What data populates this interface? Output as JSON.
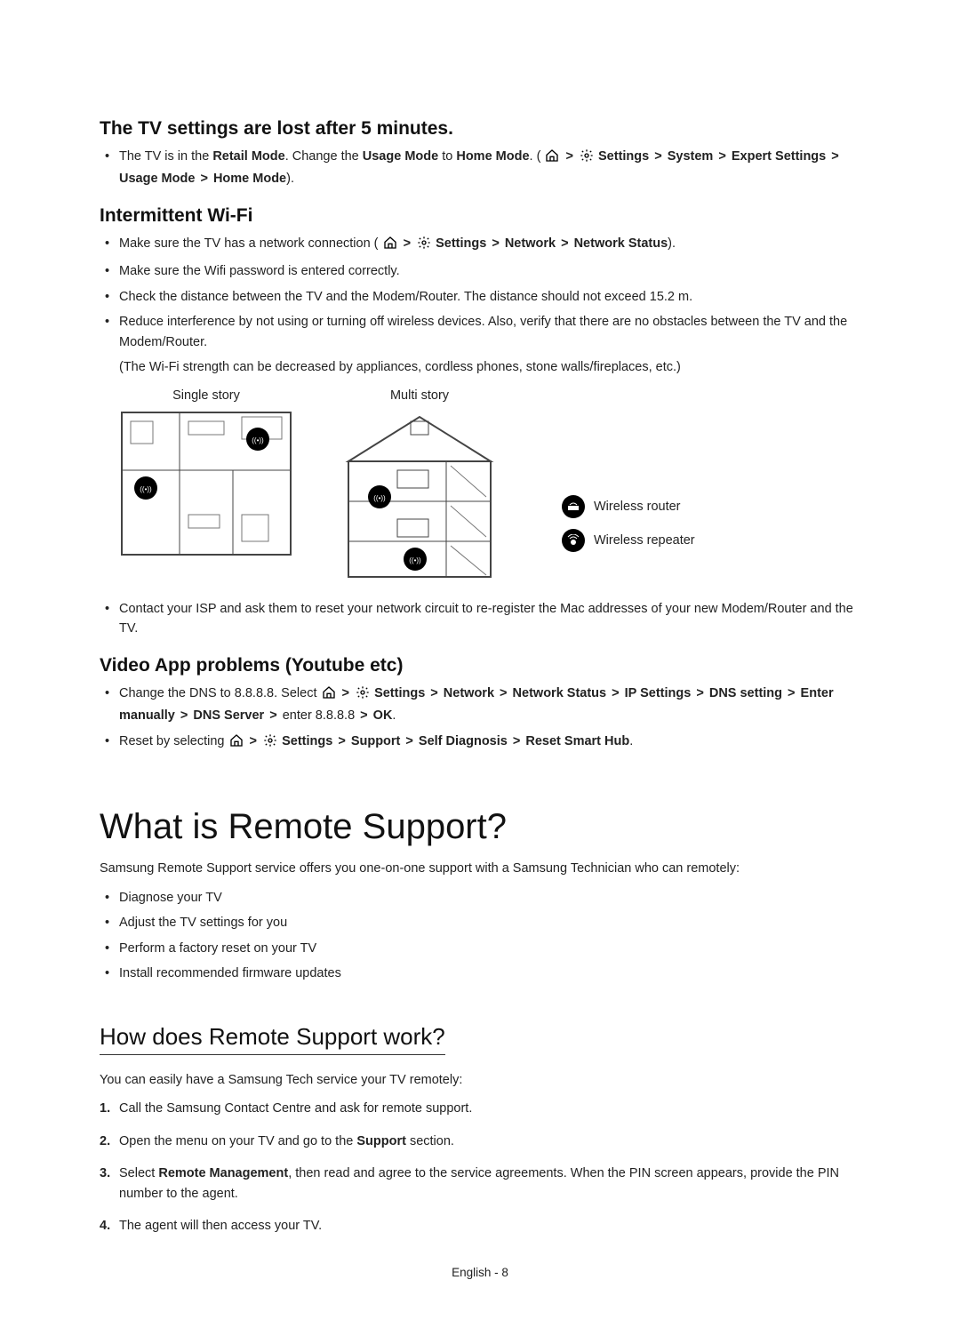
{
  "section1": {
    "heading": "The TV settings are lost after 5 minutes.",
    "bullet": {
      "pre": "The TV is in the ",
      "bold1": "Retail Mode",
      "mid": ". Change the ",
      "bold2": "Usage Mode",
      "mid2": " to ",
      "bold3": "Home Mode",
      "post": ". (",
      "path1": "Settings",
      "path2": "System",
      "path3": "Expert Settings",
      "path4": "Usage Mode",
      "path5": "Home Mode",
      "close": ")."
    }
  },
  "section2": {
    "heading": "Intermittent Wi-Fi",
    "bullets": {
      "b1_pre": "Make sure the TV has a network connection (",
      "b1_p1": "Settings",
      "b1_p2": "Network",
      "b1_p3": "Network Status",
      "b1_close": ").",
      "b2": "Make sure the Wifi password is entered correctly.",
      "b3": "Check the distance between the TV and the Modem/Router. The distance should not exceed 15.2 m.",
      "b4": "Reduce interference by not using or turning off wireless devices. Also, verify that there are no obstacles between the TV and the Modem/Router.",
      "b4_note": "(The Wi-Fi strength can be decreased by appliances, cordless phones, stone walls/fireplaces, etc.)",
      "b5": "Contact your ISP and ask them to reset your network circuit to re-register the Mac addresses of your new Modem/Router and the TV."
    },
    "dia_single": "Single story",
    "dia_multi": "Multi story",
    "legend_router": "Wireless router",
    "legend_repeater": "Wireless repeater"
  },
  "section3": {
    "heading": "Video App problems (Youtube etc)",
    "b1_pre": "Change the DNS to 8.8.8.8. Select ",
    "b1_p1": "Settings",
    "b1_p2": "Network",
    "b1_p3": "Network Status",
    "b1_p4": "IP Settings",
    "b1_p5": "DNS setting",
    "b1_p6": "Enter manually",
    "b1_p7": "DNS Server",
    "b1_mid": " enter 8.8.8.8 ",
    "b1_p8": "OK",
    "b1_close": ".",
    "b2_pre": "Reset by selecting ",
    "b2_p1": "Settings",
    "b2_p2": "Support",
    "b2_p3": "Self Diagnosis",
    "b2_p4": "Reset Smart Hub",
    "b2_close": "."
  },
  "section4": {
    "heading": "What is Remote Support?",
    "intro": "Samsung Remote Support service offers you one-on-one support with a Samsung Technician who can remotely:",
    "bullets": {
      "b1": "Diagnose your TV",
      "b2": "Adjust the TV settings for you",
      "b3": "Perform a factory reset on your TV",
      "b4": "Install recommended firmware updates"
    }
  },
  "section5": {
    "heading": "How does Remote Support work?",
    "intro": "You can easily have a Samsung Tech service your TV remotely:",
    "steps": {
      "s1": "Call the Samsung Contact Centre and ask for remote support.",
      "s2_pre": "Open the menu on your TV and go to the ",
      "s2_bold": "Support",
      "s2_post": " section.",
      "s3_pre": "Select ",
      "s3_bold": "Remote Management",
      "s3_post": ", then read and agree to the service agreements. When the PIN screen appears, provide the PIN number to the agent.",
      "s4": "The agent will then access your TV."
    }
  },
  "footer": "English - 8",
  "chev": ">"
}
